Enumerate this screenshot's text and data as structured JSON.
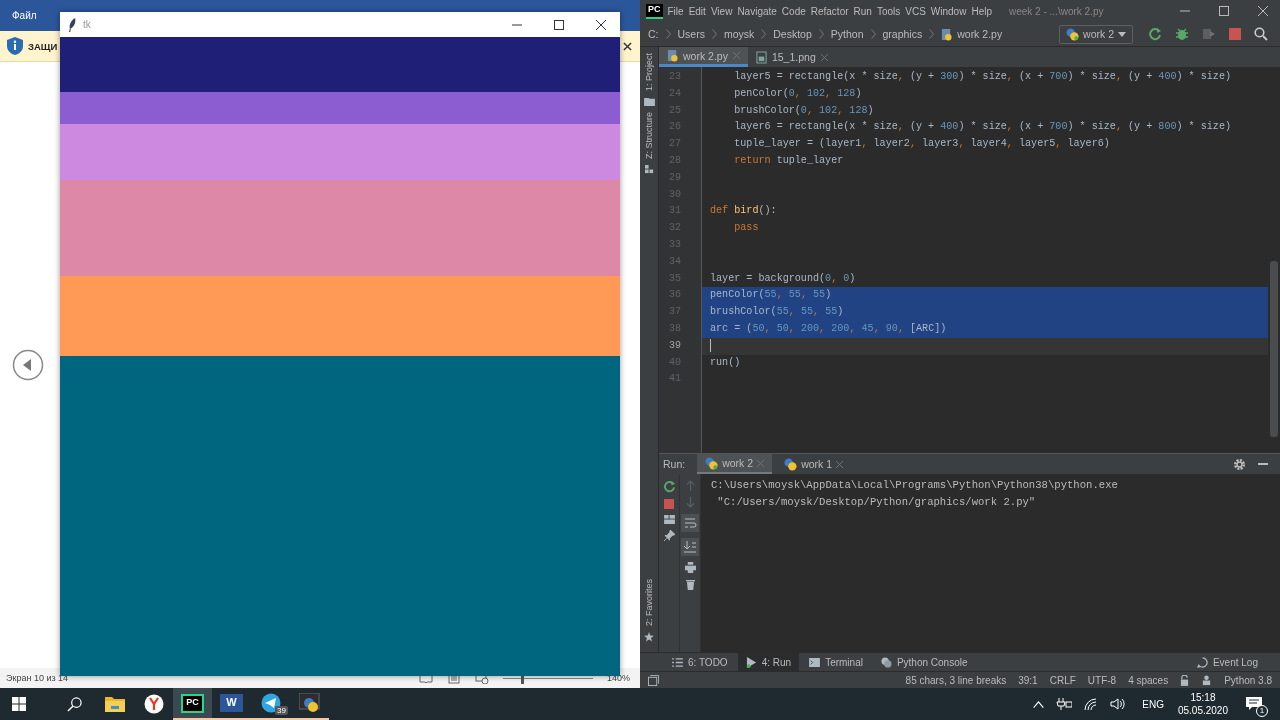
{
  "background_window": {
    "menu": "Файл",
    "banner_text": "ЗАЩИ",
    "status": "Экран 10 из 14",
    "zoom_slider": {
      "level": 0.2
    },
    "zoom": "140%"
  },
  "tk_window": {
    "title": "tk",
    "stripes": [
      {
        "color": "#201f78"
      },
      {
        "color": "#8b5dd0"
      },
      {
        "color": "#cd88e0"
      },
      {
        "color": "#dd88a6"
      },
      {
        "color": "#ff9955"
      },
      {
        "color": "#006680"
      }
    ]
  },
  "ide": {
    "logo": "PC",
    "menu": [
      "File",
      "Edit",
      "View",
      "Navigate",
      "Code",
      "Refactor",
      "Run",
      "Tools",
      "VCS",
      "Window",
      "Help"
    ],
    "title": "week 2 - ...\\work 2.py",
    "breadcrumb": [
      "C:",
      "Users",
      "moysk",
      "Desktop",
      "Python",
      "graphics",
      "work 2.py"
    ],
    "run_config": "work 2",
    "editor_tabs": [
      {
        "label": "work 2.py",
        "selected": true
      },
      {
        "label": "15_1.png",
        "selected": false
      }
    ],
    "side_tools": [
      "1: Project",
      "Z: Structure"
    ],
    "favorites": "2: Favorites",
    "code_lines": [
      {
        "number": "23",
        "selected": false,
        "current": false,
        "tokens": [
          {
            "text": "    layer5 = rectangle(x * size",
            "kind": "plain"
          },
          {
            "text": ", ",
            "kind": "comma"
          },
          {
            "text": "(y + ",
            "kind": "plain"
          },
          {
            "text": "300",
            "kind": "number"
          },
          {
            "text": ") * size",
            "kind": "plain"
          },
          {
            "text": ", ",
            "kind": "comma"
          },
          {
            "text": "(x + ",
            "kind": "plain"
          },
          {
            "text": "700",
            "kind": "number"
          },
          {
            "text": ") * size",
            "kind": "plain"
          },
          {
            "text": ", ",
            "kind": "comma"
          },
          {
            "text": "(y + ",
            "kind": "plain"
          },
          {
            "text": "400",
            "kind": "number"
          },
          {
            "text": ") * size)",
            "kind": "plain"
          }
        ]
      },
      {
        "number": "24",
        "selected": false,
        "current": false,
        "tokens": [
          {
            "text": "    penColor(",
            "kind": "plain"
          },
          {
            "text": "0",
            "kind": "number"
          },
          {
            "text": ", ",
            "kind": "comma"
          },
          {
            "text": "102",
            "kind": "number"
          },
          {
            "text": ", ",
            "kind": "comma"
          },
          {
            "text": "128",
            "kind": "number"
          },
          {
            "text": ")",
            "kind": "plain"
          }
        ]
      },
      {
        "number": "25",
        "selected": false,
        "current": false,
        "tokens": [
          {
            "text": "    brushColor(",
            "kind": "plain"
          },
          {
            "text": "0",
            "kind": "number"
          },
          {
            "text": ", ",
            "kind": "comma"
          },
          {
            "text": "102",
            "kind": "number"
          },
          {
            "text": ", ",
            "kind": "comma"
          },
          {
            "text": "128",
            "kind": "number"
          },
          {
            "text": ")",
            "kind": "plain"
          }
        ]
      },
      {
        "number": "26",
        "selected": false,
        "current": false,
        "tokens": [
          {
            "text": "    layer6 = rectangle(x * size",
            "kind": "plain"
          },
          {
            "text": ", ",
            "kind": "comma"
          },
          {
            "text": "(y + ",
            "kind": "plain"
          },
          {
            "text": "400",
            "kind": "number"
          },
          {
            "text": ") * size",
            "kind": "plain"
          },
          {
            "text": ", ",
            "kind": "comma"
          },
          {
            "text": "(x + ",
            "kind": "plain"
          },
          {
            "text": "700",
            "kind": "number"
          },
          {
            "text": ") * size",
            "kind": "plain"
          },
          {
            "text": ", ",
            "kind": "comma"
          },
          {
            "text": "(y + ",
            "kind": "plain"
          },
          {
            "text": "800",
            "kind": "number"
          },
          {
            "text": ") * size)",
            "kind": "plain"
          }
        ]
      },
      {
        "number": "27",
        "selected": false,
        "current": false,
        "tokens": [
          {
            "text": "    tuple_layer = (layer1",
            "kind": "plain"
          },
          {
            "text": ", ",
            "kind": "comma"
          },
          {
            "text": "layer2",
            "kind": "plain"
          },
          {
            "text": ", ",
            "kind": "comma"
          },
          {
            "text": "layer3",
            "kind": "plain"
          },
          {
            "text": ", ",
            "kind": "comma"
          },
          {
            "text": "layer4",
            "kind": "plain"
          },
          {
            "text": ", ",
            "kind": "comma"
          },
          {
            "text": "layer5",
            "kind": "plain"
          },
          {
            "text": ", ",
            "kind": "comma"
          },
          {
            "text": "layer6)",
            "kind": "plain"
          }
        ]
      },
      {
        "number": "28",
        "selected": false,
        "current": false,
        "tokens": [
          {
            "text": "    return",
            "kind": "keyword"
          },
          {
            "text": " tuple_layer",
            "kind": "plain"
          }
        ]
      },
      {
        "number": "29",
        "selected": false,
        "current": false
      },
      {
        "number": "30",
        "selected": false,
        "current": false
      },
      {
        "number": "31",
        "selected": false,
        "current": false,
        "tokens": [
          {
            "text": "def ",
            "kind": "keyword"
          },
          {
            "text": "bird",
            "kind": "function"
          },
          {
            "text": "():",
            "kind": "plain"
          }
        ]
      },
      {
        "number": "32",
        "selected": false,
        "current": false,
        "tokens": [
          {
            "text": "    pass",
            "kind": "keyword"
          }
        ]
      },
      {
        "number": "33",
        "selected": false,
        "current": false
      },
      {
        "number": "34",
        "selected": false,
        "current": false
      },
      {
        "number": "35",
        "selected": false,
        "current": false,
        "tokens": [
          {
            "text": "layer = background(",
            "kind": "plain"
          },
          {
            "text": "0",
            "kind": "number"
          },
          {
            "text": ", ",
            "kind": "comma"
          },
          {
            "text": "0",
            "kind": "number"
          },
          {
            "text": ")",
            "kind": "plain"
          }
        ]
      },
      {
        "number": "36",
        "selected": true,
        "current": false,
        "tokens": [
          {
            "text": "penColor(",
            "kind": "plain"
          },
          {
            "text": "55",
            "kind": "number"
          },
          {
            "text": ", ",
            "kind": "comma"
          },
          {
            "text": "55",
            "kind": "number"
          },
          {
            "text": ", ",
            "kind": "comma"
          },
          {
            "text": "55",
            "kind": "number"
          },
          {
            "text": ")",
            "kind": "plain"
          }
        ]
      },
      {
        "number": "37",
        "selected": true,
        "current": false,
        "tokens": [
          {
            "text": "brushColor(",
            "kind": "plain"
          },
          {
            "text": "55",
            "kind": "number"
          },
          {
            "text": ", ",
            "kind": "comma"
          },
          {
            "text": "55",
            "kind": "number"
          },
          {
            "text": ", ",
            "kind": "comma"
          },
          {
            "text": "55",
            "kind": "number"
          },
          {
            "text": ")",
            "kind": "plain"
          }
        ]
      },
      {
        "number": "38",
        "selected": true,
        "current": false,
        "tokens": [
          {
            "text": "arc = (",
            "kind": "plain"
          },
          {
            "text": "50",
            "kind": "number"
          },
          {
            "text": ", ",
            "kind": "comma"
          },
          {
            "text": "50",
            "kind": "number"
          },
          {
            "text": ", ",
            "kind": "comma"
          },
          {
            "text": "200",
            "kind": "number"
          },
          {
            "text": ", ",
            "kind": "comma"
          },
          {
            "text": "200",
            "kind": "number"
          },
          {
            "text": ", ",
            "kind": "comma"
          },
          {
            "text": "45",
            "kind": "number"
          },
          {
            "text": ", ",
            "kind": "comma"
          },
          {
            "text": "90",
            "kind": "number"
          },
          {
            "text": ", ",
            "kind": "comma"
          },
          {
            "text": "[ARC])",
            "kind": "plain"
          }
        ]
      },
      {
        "number": "39",
        "selected": false,
        "current": true
      },
      {
        "number": "40",
        "selected": false,
        "current": false,
        "tokens": [
          {
            "text": "run()",
            "kind": "plain"
          }
        ]
      },
      {
        "number": "41",
        "selected": false,
        "current": false
      }
    ],
    "run_panel": {
      "label": "Run:",
      "tabs": [
        {
          "label": "work 2",
          "selected": true
        },
        {
          "label": "work 1",
          "selected": false
        }
      ],
      "output": [
        "C:\\Users\\moysk\\AppData\\Local\\Programs\\Python\\Python38\\python.exe",
        " \"C:/Users/moysk/Desktop/Python/graphics/work 2.py\""
      ]
    },
    "tool_windows": [
      {
        "label": "6: TODO",
        "selected": false,
        "kind": "todo"
      },
      {
        "label": "4: Run",
        "selected": true,
        "kind": "run"
      },
      {
        "label": "Terminal",
        "selected": false,
        "kind": "terminal"
      },
      {
        "label": "Python Console",
        "selected": false,
        "kind": "console"
      }
    ],
    "event_log": "Event Log",
    "status": [
      "85 chars, 3 line breaks",
      "39:1",
      "CRLF",
      "UTF-8",
      "4 spaces",
      "Python 3.8"
    ]
  },
  "taskbar": {
    "apps": [
      {
        "kind": "explorer",
        "selected": false,
        "running": false
      },
      {
        "kind": "browser",
        "selected": false,
        "running": false
      },
      {
        "kind": "pycharm",
        "label": "PC",
        "selected": true,
        "running": true
      },
      {
        "kind": "word",
        "label": "W",
        "selected": false,
        "running": true
      },
      {
        "kind": "telegram",
        "badge": "39",
        "selected": false,
        "running": true
      },
      {
        "kind": "python",
        "selected": false,
        "running": true
      }
    ],
    "language": "ENG",
    "time": "15:18",
    "date": "05.05.2020",
    "notifications": "1"
  }
}
